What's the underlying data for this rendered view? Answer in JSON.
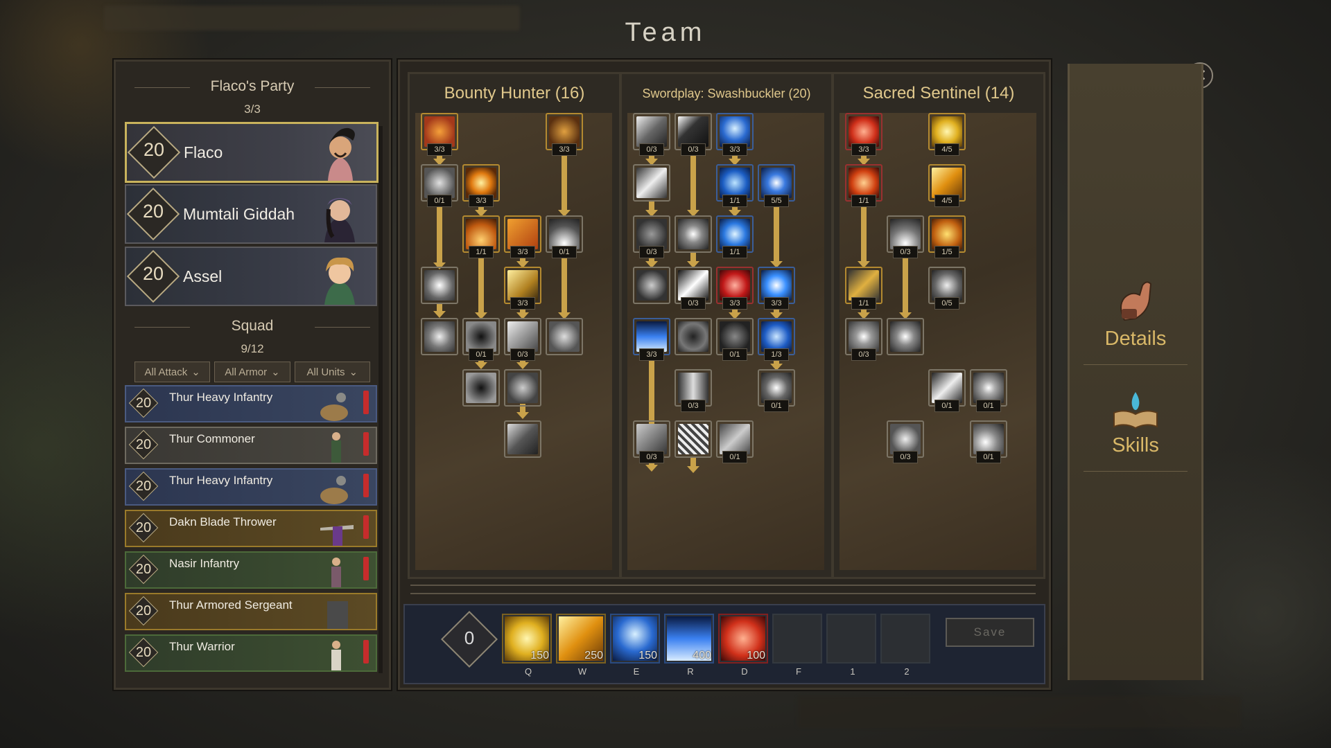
{
  "window": {
    "title": "Team",
    "close_icon": "close-icon"
  },
  "party": {
    "title": "Flaco's Party",
    "count": "3/3",
    "heroes": [
      {
        "level": "20",
        "name": "Flaco",
        "selected": true
      },
      {
        "level": "20",
        "name": "Mumtali Giddah",
        "selected": false
      },
      {
        "level": "20",
        "name": "Assel",
        "selected": false
      }
    ]
  },
  "squad": {
    "title": "Squad",
    "count": "9/12",
    "filters": [
      "All Attack",
      "All Armor",
      "All Units"
    ],
    "units": [
      {
        "level": "20",
        "name": "Thur Heavy Infantry",
        "color": "#4a5a80"
      },
      {
        "level": "20",
        "name": "Thur Commoner",
        "color": "#6e6a60"
      },
      {
        "level": "20",
        "name": "Thur Heavy Infantry",
        "color": "#4a5a80"
      },
      {
        "level": "20",
        "name": "Dakn Blade Thrower",
        "color": "#9a7a2a"
      },
      {
        "level": "20",
        "name": "Nasir Infantry",
        "color": "#4c6a3a"
      },
      {
        "level": "20",
        "name": "Thur Armored Sergeant",
        "color": "#9a7a2a"
      },
      {
        "level": "20",
        "name": "Thur Warrior",
        "color": "#4c6a3a"
      }
    ]
  },
  "trees": [
    {
      "title": "Bounty Hunter (16)",
      "ranks": [
        "3/3",
        "3/3",
        "0/1",
        "3/3",
        "1/1",
        "3/3",
        "0/1",
        "3/3",
        "0/1",
        "0/3"
      ]
    },
    {
      "title": "Swordplay: Swashbuckler (20)",
      "ranks": [
        "0/3",
        "0/3",
        "3/3",
        "1/1",
        "5/5",
        "0/3",
        "1/1",
        "0/3",
        "3/3",
        "3/3",
        "3/3",
        "0/1",
        "1/3",
        "0/3",
        "0/1",
        "0/3",
        "0/1"
      ]
    },
    {
      "title": "Sacred Sentinel (14)",
      "ranks": [
        "3/3",
        "4/5",
        "1/1",
        "4/5",
        "0/3",
        "1/5",
        "1/1",
        "0/5",
        "0/3",
        "0/1",
        "0/1",
        "0/3",
        "0/1"
      ]
    }
  ],
  "bar": {
    "skill_points": "0",
    "slots": [
      {
        "key": "Q",
        "cost": "150"
      },
      {
        "key": "W",
        "cost": "250"
      },
      {
        "key": "E",
        "cost": "150"
      },
      {
        "key": "R",
        "cost": "400"
      },
      {
        "key": "D",
        "cost": "100"
      },
      {
        "key": "F",
        "cost": ""
      },
      {
        "key": "1",
        "cost": ""
      },
      {
        "key": "2",
        "cost": ""
      }
    ],
    "save_label": "Save"
  },
  "side_tabs": [
    {
      "label": "Details",
      "icon": "arm-icon"
    },
    {
      "label": "Skills",
      "icon": "book-icon"
    }
  ]
}
